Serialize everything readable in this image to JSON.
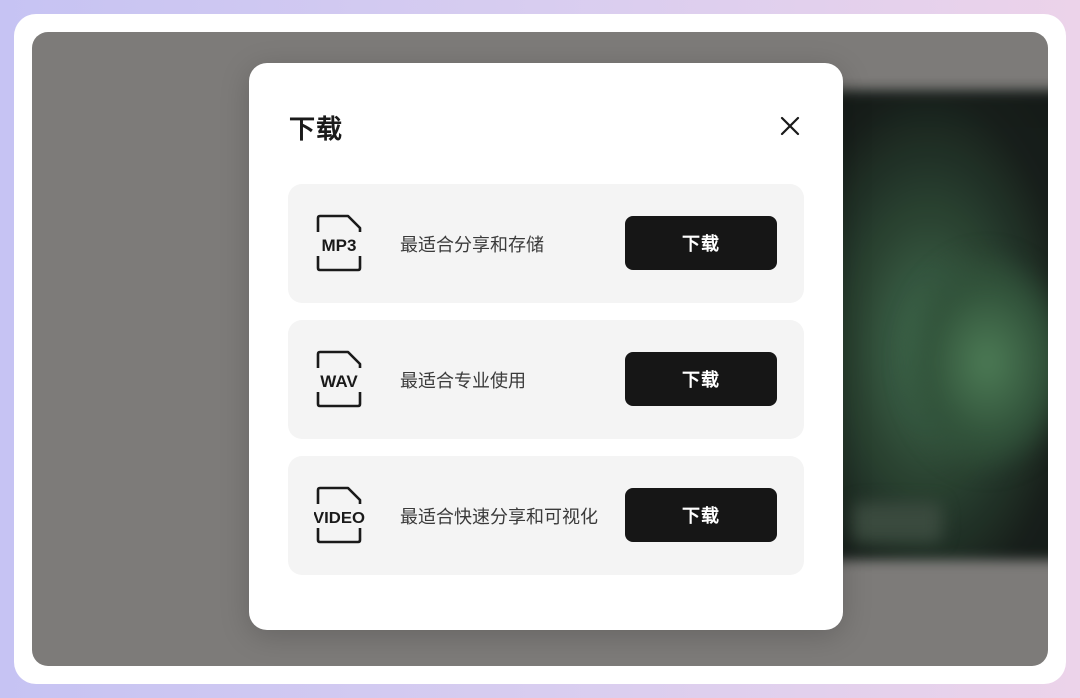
{
  "dialog": {
    "title": "下载",
    "close_icon": "close-icon"
  },
  "options": [
    {
      "format": "MP3",
      "icon": "mp3-file-icon",
      "description": "最适合分享和存储",
      "button_label": "下载"
    },
    {
      "format": "WAV",
      "icon": "wav-file-icon",
      "description": "最适合专业使用",
      "button_label": "下载"
    },
    {
      "format": "VIDEO",
      "icon": "video-file-icon",
      "description": "最适合快速分享和可视化",
      "button_label": "下载"
    }
  ],
  "colors": {
    "button_bg": "#161616",
    "card_bg": "#f4f4f4",
    "overlay": "#7d7b79"
  }
}
